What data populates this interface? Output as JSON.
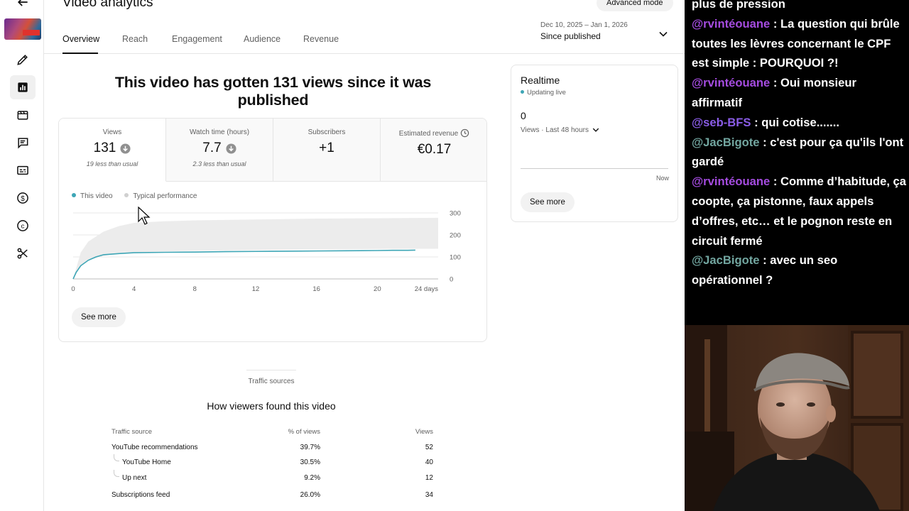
{
  "studio": {
    "page_title": "Video analytics",
    "advanced_mode_label": "Advanced mode",
    "tabs": [
      {
        "label": "Overview"
      },
      {
        "label": "Reach"
      },
      {
        "label": "Engagement"
      },
      {
        "label": "Audience"
      },
      {
        "label": "Revenue"
      }
    ],
    "date_range": {
      "dates": "Dec 10, 2025 – Jan 1, 2026",
      "label": "Since published"
    },
    "headline": "This video has gotten 131 views since it was published",
    "kpis": [
      {
        "label": "Views",
        "value": "131",
        "sub": "19 less than usual"
      },
      {
        "label": "Watch time (hours)",
        "value": "7.7",
        "sub": "2.3 less than usual"
      },
      {
        "label": "Subscribers",
        "value": "+1",
        "sub": ""
      },
      {
        "label": "Estimated revenue",
        "value": "€0.17",
        "sub": ""
      }
    ],
    "legend": {
      "this_video": "This video",
      "typical": "Typical performance"
    },
    "see_more_label": "See more",
    "realtime": {
      "title": "Realtime",
      "status": "Updating live",
      "count": "0",
      "range": "Views · Last 48 hours",
      "now_label": "Now",
      "see_more_label": "See more"
    },
    "traffic": {
      "eyebrow": "Traffic sources",
      "title": "How viewers found this video",
      "headers": [
        "Traffic source",
        "% of views",
        "Views"
      ],
      "rows": [
        {
          "source": "YouTube recommendations",
          "pct": "39.7%",
          "views": "52"
        },
        {
          "source": "YouTube Home",
          "pct": "30.5%",
          "views": "40"
        },
        {
          "source": "Up next",
          "pct": "9.2%",
          "views": "12"
        },
        {
          "source": "Subscriptions feed",
          "pct": "26.0%",
          "views": "34"
        }
      ]
    },
    "colors": {
      "accent": "#3ea6b6",
      "band": "#ececec",
      "text": "#0f0f0f",
      "muted": "#606060"
    }
  },
  "chart_data": {
    "type": "line",
    "x_tick_labels": [
      "0",
      "4",
      "8",
      "12",
      "16",
      "20",
      "24 days"
    ],
    "y_tick_labels": [
      "0",
      "100",
      "200",
      "300"
    ],
    "xlim": [
      0,
      24
    ],
    "ylim": [
      0,
      300
    ],
    "series": [
      {
        "name": "This video",
        "x": [
          0,
          0.2,
          0.5,
          1,
          1.5,
          2,
          3,
          4,
          6,
          8,
          10,
          12,
          14,
          16,
          18,
          20,
          21,
          22,
          22.5
        ],
        "y": [
          0,
          30,
          60,
          85,
          100,
          110,
          115,
          119,
          121,
          122,
          124,
          125,
          126,
          127,
          128,
          129,
          130,
          130,
          131
        ]
      },
      {
        "name": "Typical performance",
        "x": [
          0,
          0.5,
          1,
          2,
          3,
          4,
          6,
          8,
          12,
          16,
          20,
          24
        ],
        "upper": [
          0,
          120,
          170,
          215,
          240,
          255,
          262,
          266,
          270,
          274,
          276,
          278
        ],
        "lower": [
          0,
          60,
          85,
          105,
          115,
          120,
          125,
          128,
          131,
          134,
          136,
          137
        ]
      }
    ]
  },
  "chat": {
    "messages": [
      {
        "user": "",
        "text": "plus de pression",
        "color": "#a54ce0"
      },
      {
        "user": "@rvintéouane",
        "text": " : La question qui brûle toutes les lèvres concernant le CPF est simple : POURQUOI ?!",
        "color": "#a54ce0"
      },
      {
        "user": "@rvintéouane",
        "text": " : Oui monsieur affirmatif",
        "color": "#a54ce0"
      },
      {
        "user": "@seb-BFS",
        "text": " : qui cotise.......",
        "color": "#8a5ce6"
      },
      {
        "user": "@JacBigote",
        "text": " : c'est pour ça qu'ils l'ont gardé",
        "color": "#72a6a0"
      },
      {
        "user": "@rvintéouane",
        "text": " : Comme d’habitude, ça coopte, ça pistonne, faux appels d’offres, etc… et le pognon reste en circuit fermé",
        "color": "#a54ce0"
      },
      {
        "user": "@JacBigote",
        "text": " : avec un seo opérationnel ?",
        "color": "#72a6a0"
      }
    ]
  }
}
